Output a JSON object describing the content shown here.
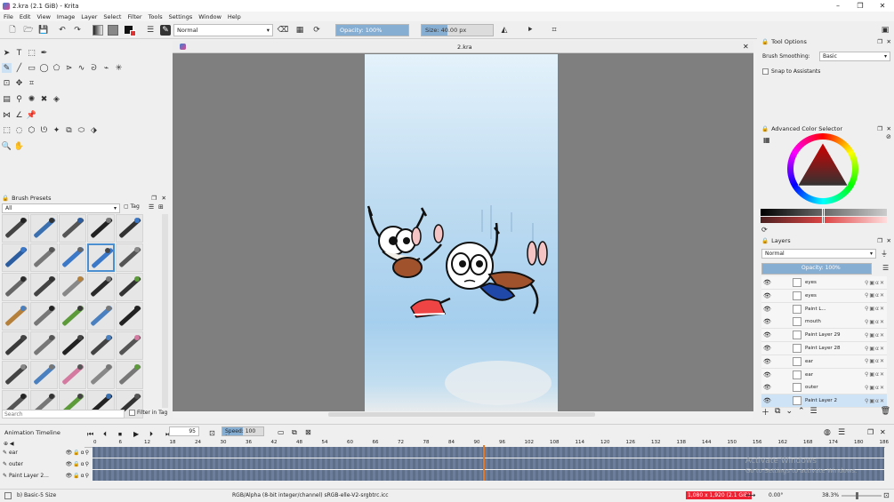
{
  "window": {
    "title": "2.kra (2.1 GiB) - Krita",
    "minimize": "–",
    "maximize": "❐",
    "close": "✕"
  },
  "menu": [
    "File",
    "Edit",
    "View",
    "Image",
    "Layer",
    "Select",
    "Filter",
    "Tools",
    "Settings",
    "Window",
    "Help"
  ],
  "toolbar": {
    "blend_mode": "Normal",
    "opacity": "Opacity: 100%",
    "opacity_value": 1.0,
    "size": "Size: 40.00 px",
    "size_value": 0.36
  },
  "brush_presets": {
    "title": "Brush Presets",
    "filter": "All",
    "tag": "Tag",
    "search_placeholder": "Search",
    "filter_in_tag": "Filter in Tag"
  },
  "document": {
    "tab": "2.kra"
  },
  "tool_options": {
    "title": "Tool Options",
    "smoothing_label": "Brush Smoothing:",
    "smoothing_value": "Basic",
    "snap_label": "Snap to Assistants"
  },
  "color_selector": {
    "title": "Advanced Color Selector"
  },
  "layers": {
    "title": "Layers",
    "blend": "Normal",
    "opacity": "Opacity: 100%",
    "items": [
      {
        "name": "eyes",
        "selected": false
      },
      {
        "name": "eyes",
        "selected": false
      },
      {
        "name": "Paint L...",
        "selected": false
      },
      {
        "name": "mouth",
        "selected": false
      },
      {
        "name": "Paint Layer 29",
        "selected": false
      },
      {
        "name": "Paint Layer 28",
        "selected": false
      },
      {
        "name": "ear",
        "selected": false
      },
      {
        "name": "ear",
        "selected": false
      },
      {
        "name": "outer",
        "selected": false
      },
      {
        "name": "Paint Layer 2",
        "selected": true
      }
    ]
  },
  "timeline": {
    "title": "Animation Timeline",
    "frame": "95",
    "speed": "Speed: 100 %",
    "ruler": [
      "0",
      "6",
      "12",
      "18",
      "24",
      "30",
      "36",
      "42",
      "48",
      "54",
      "60",
      "66",
      "72",
      "78",
      "84",
      "90",
      "96",
      "102",
      "108",
      "114",
      "120",
      "126",
      "132",
      "138",
      "144",
      "150",
      "156",
      "162",
      "168",
      "174",
      "180",
      "186"
    ],
    "tracks": [
      "ear",
      "outer",
      "Paint Layer 2..."
    ]
  },
  "watermark": {
    "line1": "Activate Windows",
    "line2": "Go to Settings to activate Windows."
  },
  "status": {
    "brush": "b) Basic-5 Size",
    "color_space": "RGB/Alpha (8-bit integer/channel)  sRGB-elle-V2-srgbtrc.icc",
    "dims": "1,080 x 1,920 (2.1 GiB)",
    "rotation": "0.00°",
    "zoom": "38.3%"
  },
  "colors": {
    "accent": "#86aed3",
    "selected": "#cfe3f7",
    "track": "#5e6f8a",
    "playhead": "#e07a2a"
  }
}
